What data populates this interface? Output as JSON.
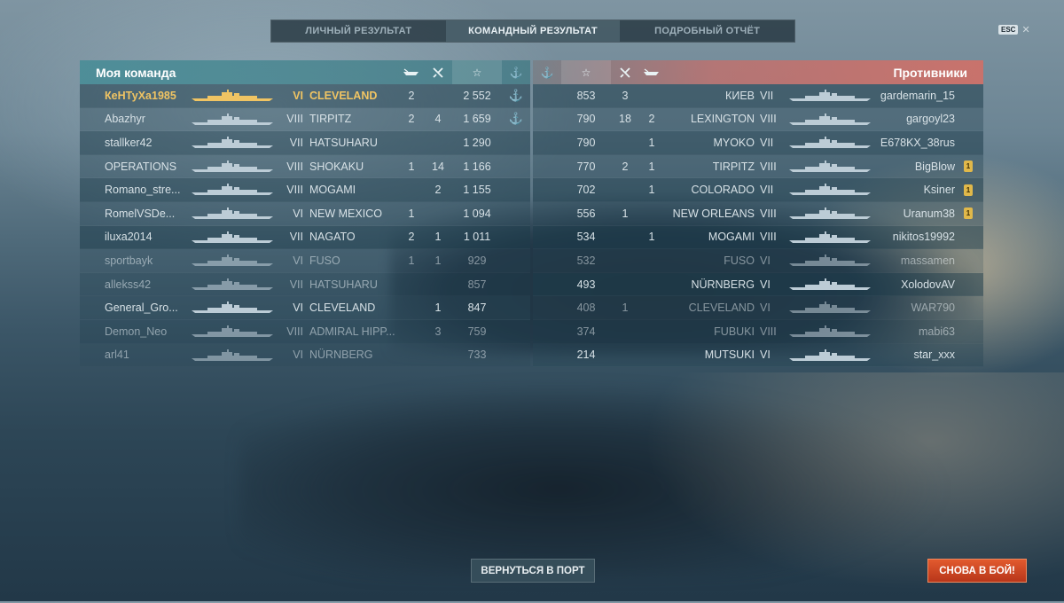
{
  "tabs": [
    "ЛИЧНЫЙ РЕЗУЛЬТАТ",
    "КОМАНДНЫЙ РЕЗУЛЬТАТ",
    "ПОДРОБНЫЙ ОТЧЁТ"
  ],
  "active_tab": 1,
  "esc": {
    "key": "ESC",
    "close": "✕"
  },
  "left_team": {
    "title": "Моя команда",
    "header_icons": {
      "ships": "ship-kill-icon",
      "planes": "plane-kill-icon",
      "exp": "☆",
      "base": "⚓"
    },
    "rows": [
      {
        "player": "КеНТуХа1985",
        "tier": "VI",
        "ship": "CLEVELAND",
        "kills": "2",
        "planes": "",
        "exp": "2 552",
        "base": "⚓",
        "self": true
      },
      {
        "player": "Abazhyr",
        "tier": "VIII",
        "ship": "TIRPITZ",
        "kills": "2",
        "planes": "4",
        "exp": "1 659",
        "base": "⚓"
      },
      {
        "player": "stallker42",
        "tier": "VII",
        "ship": "HATSUHARU",
        "kills": "",
        "planes": "",
        "exp": "1 290",
        "base": ""
      },
      {
        "player": "OPERATIONS",
        "tier": "VIII",
        "ship": "SHOKAKU",
        "kills": "1",
        "planes": "14",
        "exp": "1 166",
        "base": ""
      },
      {
        "player": "Romano_stre...",
        "tier": "VIII",
        "ship": "MOGAMI",
        "kills": "",
        "planes": "2",
        "exp": "1 155",
        "base": ""
      },
      {
        "player": "RomelVSDe...",
        "tier": "VI",
        "ship": "NEW MEXICO",
        "kills": "1",
        "planes": "",
        "exp": "1 094",
        "base": ""
      },
      {
        "player": "iluxa2014",
        "tier": "VII",
        "ship": "NAGATO",
        "kills": "2",
        "planes": "1",
        "exp": "1 011",
        "base": ""
      },
      {
        "player": "sportbayk",
        "tier": "VI",
        "ship": "FUSO",
        "kills": "1",
        "planes": "1",
        "exp": "929",
        "base": "",
        "dim": true
      },
      {
        "player": "allekss42",
        "tier": "VII",
        "ship": "HATSUHARU",
        "kills": "",
        "planes": "",
        "exp": "857",
        "base": "",
        "dim": true
      },
      {
        "player": "General_Gro...",
        "tier": "VI",
        "ship": "CLEVELAND",
        "kills": "",
        "planes": "1",
        "exp": "847",
        "base": ""
      },
      {
        "player": "Demon_Neo",
        "tier": "VIII",
        "ship": "ADMIRAL HIPP...",
        "kills": "",
        "planes": "3",
        "exp": "759",
        "base": "",
        "dim": true
      },
      {
        "player": "arl41",
        "tier": "VI",
        "ship": "NÜRNBERG",
        "kills": "",
        "planes": "",
        "exp": "733",
        "base": "",
        "dim": true
      }
    ]
  },
  "right_team": {
    "title": "Противники",
    "header_icons": {
      "base": "⚓",
      "exp": "☆",
      "planes": "plane-kill-icon",
      "ships": "ship-kill-icon"
    },
    "rows": [
      {
        "player": "gardemarin_15",
        "tier": "VII",
        "ship": "КИЕВ",
        "kills": "",
        "planes": "3",
        "exp": "853",
        "medal": false
      },
      {
        "player": "gargoyl23",
        "tier": "VIII",
        "ship": "LEXINGTON",
        "kills": "2",
        "planes": "18",
        "exp": "790",
        "medal": false
      },
      {
        "player": "E678KX_38rus",
        "tier": "VII",
        "ship": "MYOKO",
        "kills": "1",
        "planes": "",
        "exp": "790",
        "medal": false
      },
      {
        "player": "BigBlow",
        "tier": "VIII",
        "ship": "TIRPITZ",
        "kills": "1",
        "planes": "2",
        "exp": "770",
        "medal": true
      },
      {
        "player": "Ksiner",
        "tier": "VII",
        "ship": "COLORADO",
        "kills": "1",
        "planes": "",
        "exp": "702",
        "medal": true
      },
      {
        "player": "Uranum38",
        "tier": "VIII",
        "ship": "NEW ORLEANS",
        "kills": "",
        "planes": "1",
        "exp": "556",
        "medal": true
      },
      {
        "player": "nikitos19992",
        "tier": "VIII",
        "ship": "MOGAMI",
        "kills": "1",
        "planes": "",
        "exp": "534",
        "medal": false
      },
      {
        "player": "massamen",
        "tier": "VI",
        "ship": "FUSO",
        "kills": "",
        "planes": "",
        "exp": "532",
        "medal": false,
        "dim": true
      },
      {
        "player": "XolodovAV",
        "tier": "VI",
        "ship": "NÜRNBERG",
        "kills": "",
        "planes": "",
        "exp": "493",
        "medal": false
      },
      {
        "player": "WAR790",
        "tier": "VI",
        "ship": "CLEVELAND",
        "kills": "",
        "planes": "1",
        "exp": "408",
        "medal": false,
        "dim": true
      },
      {
        "player": "mabi63",
        "tier": "VIII",
        "ship": "FUBUKI",
        "kills": "",
        "planes": "",
        "exp": "374",
        "medal": false,
        "dim": true
      },
      {
        "player": "star_xxx",
        "tier": "VI",
        "ship": "MUTSUKI",
        "kills": "",
        "planes": "",
        "exp": "214",
        "medal": false
      }
    ]
  },
  "buttons": {
    "port": "ВЕРНУТЬСЯ В ПОРТ",
    "battle": "СНОВА В БОЙ!"
  },
  "colors": {
    "self": "#f0c463",
    "battle": "#d0462a",
    "medal": "#e0b84a"
  }
}
